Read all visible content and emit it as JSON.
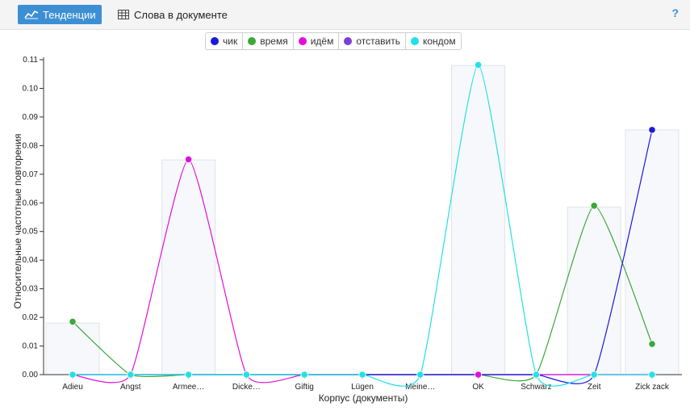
{
  "toolbar": {
    "tab_trends": "Тенденции",
    "tab_words": "Слова в документе",
    "help": "?"
  },
  "chart_data": {
    "type": "line",
    "title": "",
    "xlabel": "Корпус (документы)",
    "ylabel": "Относительные частотные повторения",
    "categories": [
      "Adieu",
      "Angst",
      "Armee…",
      "Dicke…",
      "Giftig",
      "Lügen",
      "Meine…",
      "OK",
      "Schwarz",
      "Zeit",
      "Zick zack"
    ],
    "ylim": [
      0,
      0.11
    ],
    "yticks": [
      "0.00",
      "0.01",
      "0.02",
      "0.03",
      "0.04",
      "0.05",
      "0.06",
      "0.07",
      "0.08",
      "0.09",
      "0.10",
      "0.11"
    ],
    "grid": false,
    "legend_position": "top-center",
    "series": [
      {
        "name": "чик",
        "color": "#1a1adb",
        "values": [
          0,
          0,
          0,
          0,
          0,
          0,
          0,
          0,
          0,
          0,
          0.0855
        ]
      },
      {
        "name": "время",
        "color": "#3aa83a",
        "values": [
          0.0185,
          0,
          0,
          0,
          0,
          0,
          0,
          0,
          0,
          0.059,
          0.0107
        ]
      },
      {
        "name": "идём",
        "color": "#e010d8",
        "values": [
          0,
          0,
          0.0752,
          0,
          0,
          0,
          0,
          0,
          0,
          0,
          0
        ]
      },
      {
        "name": "отставить",
        "color": "#7a3fd8",
        "values": [
          0,
          0,
          0,
          0,
          0,
          0,
          0,
          0,
          0,
          0,
          0
        ]
      },
      {
        "name": "кондом",
        "color": "#22e0e8",
        "values": [
          0,
          0,
          0,
          0,
          0,
          0,
          0,
          0.1082,
          0,
          0,
          0
        ]
      }
    ],
    "bar_values": [
      0.018,
      0,
      0.075,
      0,
      0,
      0,
      0,
      0.108,
      0,
      0.0585,
      0.0855
    ]
  }
}
